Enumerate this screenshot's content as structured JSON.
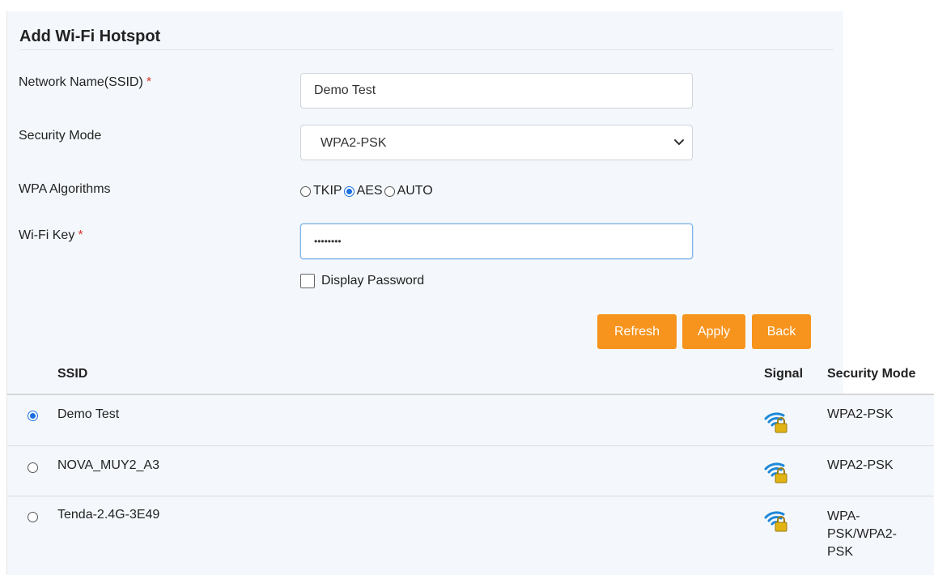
{
  "form": {
    "title": "Add Wi-Fi Hotspot",
    "ssid_label": "Network Name(SSID)",
    "ssid_value": "Demo Test",
    "security_label": "Security Mode",
    "security_value": "WPA2-PSK",
    "algorithms_label": "WPA Algorithms",
    "algorithms": [
      {
        "label": "TKIP",
        "checked": false
      },
      {
        "label": "AES",
        "checked": true
      },
      {
        "label": "AUTO",
        "checked": false
      }
    ],
    "key_label": "Wi-Fi Key",
    "key_value": "••••••••",
    "display_password_label": "Display Password",
    "required_mark": "*"
  },
  "buttons": {
    "refresh": "Refresh",
    "apply": "Apply",
    "back": "Back"
  },
  "table": {
    "headers": {
      "ssid": "SSID",
      "signal": "Signal",
      "security": "Security Mode"
    },
    "rows": [
      {
        "ssid": "Demo Test",
        "security": "WPA2-PSK",
        "selected": true,
        "signal_icon": "wifi-lock-icon"
      },
      {
        "ssid": "NOVA_MUY2_A3",
        "security": "WPA2-PSK",
        "selected": false,
        "signal_icon": "wifi-lock-icon"
      },
      {
        "ssid": "Tenda-2.4G-3E49",
        "security_lines": [
          "WPA-",
          "PSK/WPA2-",
          "PSK"
        ],
        "selected": false,
        "signal_icon": "wifi-lock-icon"
      }
    ]
  },
  "colors": {
    "accent": "#f7941d",
    "radio_selected": "#1a6fe0",
    "panel_bg": "#f4f8fc",
    "required": "#d9372b",
    "wifi_blue": "#1e88d8",
    "lock_gold": "#e2b413"
  }
}
